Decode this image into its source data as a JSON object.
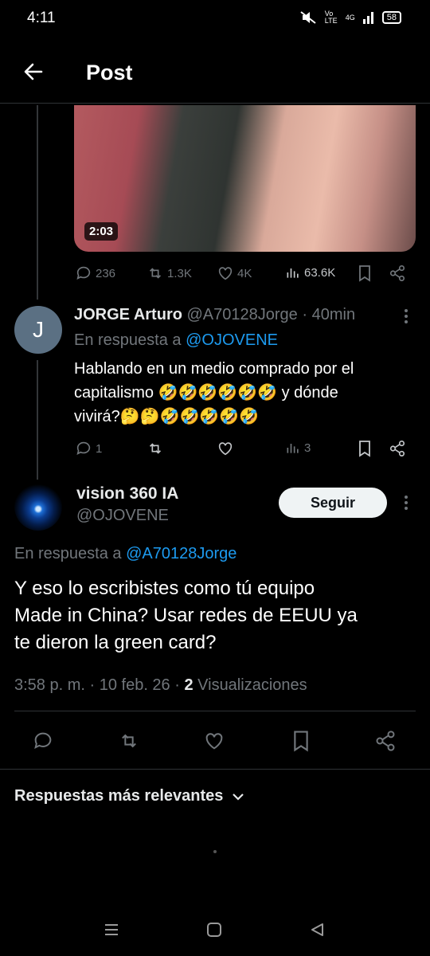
{
  "status_bar": {
    "time": "4:11",
    "volte": "Vo LTE",
    "network": "4G",
    "battery": "58"
  },
  "header": {
    "title": "Post"
  },
  "parent_post": {
    "video_duration": "2:03",
    "replies": "236",
    "reposts": "1.3K",
    "likes": "4K",
    "views": "63.6K"
  },
  "reply_jorge": {
    "avatar_letter": "J",
    "name": "JORGE Arturo",
    "handle": "@A70128Jorge",
    "separator": "·",
    "time": "40min",
    "replying_prefix": "En respuesta a",
    "replying_to": "@OJOVENE",
    "text_line1": "Hablando en un medio comprado por el",
    "text_line2": "capitalismo 🤣🤣🤣🤣🤣🤣 y dónde",
    "text_line3": "vivirá?🤔🤔🤣🤣🤣🤣🤣",
    "replies": "1",
    "views": "3"
  },
  "main_post": {
    "name": "vision 360 IA",
    "handle": "@OJOVENE",
    "follow_label": "Seguir",
    "replying_prefix": "En respuesta a",
    "replying_to": "@A70128Jorge",
    "text_line1": "Y eso lo escribistes como tú equipo",
    "text_line2": "Made in China? Usar redes de EEUU ya",
    "text_line3": "te dieron la green card?",
    "timestamp": "3:58 p. m. · 10 feb. 26 ·",
    "views_count": "2",
    "views_label": "Visualizaciones"
  },
  "sort": {
    "label": "Respuestas más relevantes"
  },
  "colors": {
    "link": "#1d9bf0",
    "muted": "#71767b",
    "text": "#e7e9ea",
    "background": "#000000"
  }
}
